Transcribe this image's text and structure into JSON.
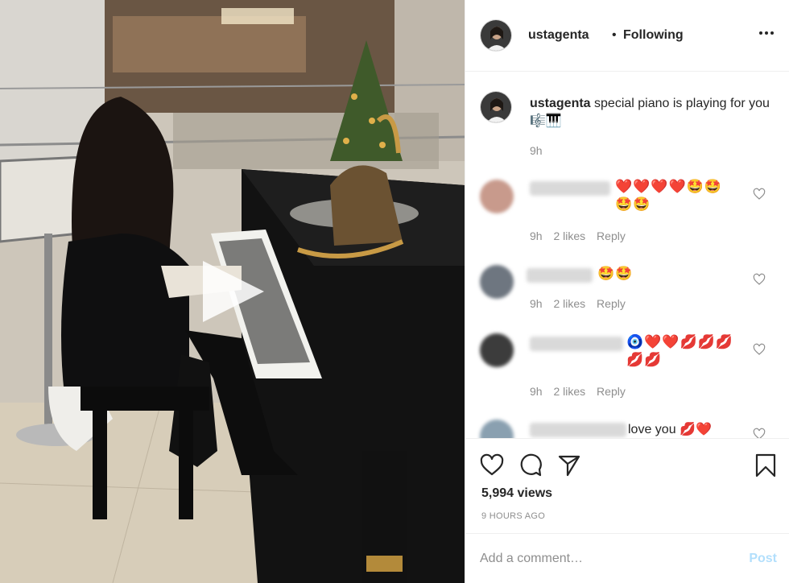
{
  "post": {
    "username": "ustagenta",
    "separator": "•",
    "follow_status": "Following",
    "more_icon": "more-horizontal-icon"
  },
  "caption": {
    "username": "ustagenta",
    "text": "special piano is playing for you 🎼🎹",
    "time": "9h"
  },
  "comments": [
    {
      "username_visible": false,
      "text": "❤️❤️❤️❤️🤩🤩🤩🤩",
      "time": "9h",
      "likes": "2 likes",
      "reply": "Reply",
      "avatar_color": "#c89a8c"
    },
    {
      "username_visible": false,
      "text": "🤩🤩",
      "time": "9h",
      "likes": "2 likes",
      "reply": "Reply",
      "avatar_color": "#6e7680"
    },
    {
      "username_visible": false,
      "text": "🧿❤️❤️💋💋💋💋💋",
      "time": "9h",
      "likes": "2 likes",
      "reply": "Reply",
      "avatar_color": "#3c3c3c"
    },
    {
      "username_visible": false,
      "text": "love you 💋❤️",
      "avatar_color": "#8aa0b0"
    }
  ],
  "actions": {
    "like_icon": "heart-icon",
    "comment_icon": "comment-icon",
    "share_icon": "paper-plane-icon",
    "save_icon": "bookmark-icon"
  },
  "stats": {
    "views": "5,994 views",
    "time_ago": "9 HOURS AGO"
  },
  "composer": {
    "placeholder": "Add a comment…",
    "post_label": "Post"
  },
  "colors": {
    "text_primary": "#262626",
    "text_secondary": "#8e8e8e",
    "border": "#efefef",
    "post_button_disabled": "#b2dffc"
  }
}
